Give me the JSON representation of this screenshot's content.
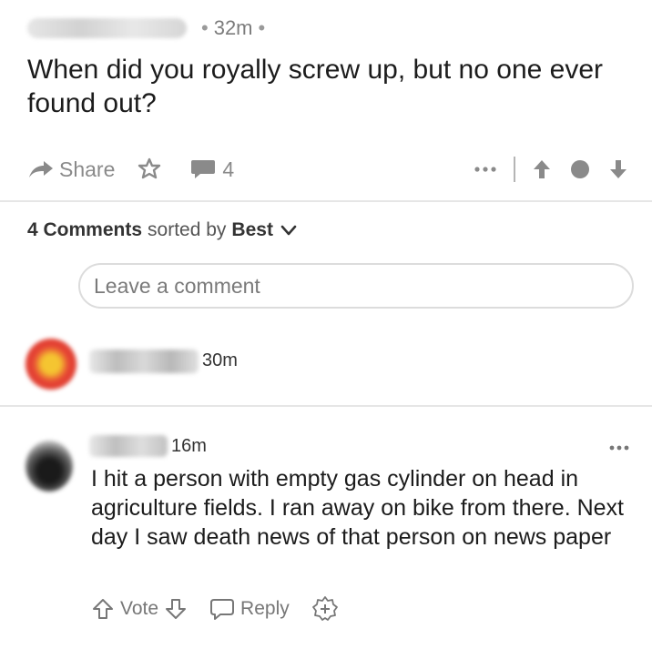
{
  "post": {
    "time": "32m",
    "title": "When did you royally screw up, but no one ever found out?",
    "share_label": "Share",
    "comment_count": "4"
  },
  "comments_bar": {
    "count_label": "4 Comments",
    "sorted_label": "sorted by",
    "sort_value": "Best"
  },
  "comment_input": {
    "placeholder": "Leave a comment"
  },
  "comments": [
    {
      "time": "30m"
    },
    {
      "time": "16m",
      "body": "I hit a person with empty gas cylinder on head in agriculture fields. I ran away on bike from there. Next day I saw death news of that person on news paper",
      "vote_label": "Vote",
      "reply_label": "Reply"
    }
  ],
  "icons": [
    "share-arrow-icon",
    "award-icon",
    "comment-bubble-icon",
    "more-dots-icon",
    "upvote-arrow-icon",
    "vote-dot-icon",
    "downvote-arrow-icon",
    "chevron-down-icon",
    "upvote-outline-icon",
    "downvote-outline-icon",
    "reply-bubble-icon",
    "award-plus-icon"
  ],
  "colors": {
    "text": "#1c1c1c",
    "muted": "#8a8a8a",
    "divider": "#e6e6e6"
  }
}
